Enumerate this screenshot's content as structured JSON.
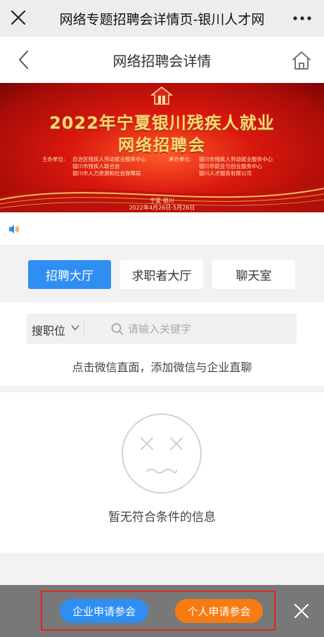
{
  "wechat_bar": {
    "title": "网络专题招聘会详情页-银川人才网",
    "close_icon": "close-icon",
    "more_icon": "more-icon"
  },
  "nav": {
    "title": "网络招聘会详情",
    "back_icon": "chevron-left-icon",
    "home_icon": "home-icon"
  },
  "banner": {
    "title_line1": "2022年宁夏银川残疾人就业",
    "title_line2": "网络招聘会",
    "organizer_label": "主办单位:",
    "organizers": [
      "自治区残疾人劳动就业服务中心",
      "银川市残疾人联合会",
      "银川市人力资源和社会保障局"
    ],
    "co_organizer_label": "承办单位:",
    "co_organizers": [
      "银川市残疾人劳动就业服务中心",
      "银川市就业与创业服务中心",
      "银川人才服务有限公司"
    ],
    "location": "宁夏·银川",
    "dates": "2022年4月26日-5月26日"
  },
  "tabs": [
    {
      "label": "招聘大厅",
      "active": true
    },
    {
      "label": "求职者大厅",
      "active": false
    },
    {
      "label": "聊天室",
      "active": false
    }
  ],
  "search": {
    "type_label": "搜职位",
    "placeholder": "请输入关键字",
    "hint": "点击微信直面，添加微信与企业直聊"
  },
  "empty": {
    "message": "暂无符合条件的信息"
  },
  "bottom": {
    "company_button": "企业申请参会",
    "personal_button": "个人申请参会"
  },
  "colors": {
    "primary_blue": "#2f8ef2",
    "accent_orange": "#f77b13",
    "highlight_red": "#e1261c",
    "banner_red": "#d9180e"
  }
}
